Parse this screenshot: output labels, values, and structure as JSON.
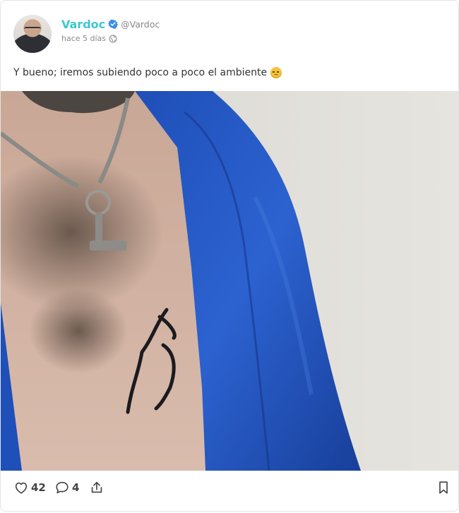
{
  "post": {
    "author": {
      "display_name": "Vardoc",
      "handle": "@Vardoc",
      "verified": true,
      "avatar_icon": "avatar-photo"
    },
    "time": "hace 5 días",
    "visibility_icon": "globe-icon",
    "text": "Y bueno; iremos subiendo poco a poco el ambiente",
    "emoji_icon": "pensive-face-emoji",
    "media": {
      "type": "photo",
      "icon": "photo"
    },
    "actions": {
      "like_count": "42",
      "comment_count": "4",
      "like_icon": "heart-icon",
      "comment_icon": "speech-bubble-icon",
      "share_icon": "share-icon",
      "bookmark_icon": "bookmark-icon"
    }
  },
  "colors": {
    "accent": "#3ec7cf",
    "verified": "#3a8ee6",
    "text": "#333333",
    "muted": "#8a8a8a",
    "icon": "#444444"
  }
}
